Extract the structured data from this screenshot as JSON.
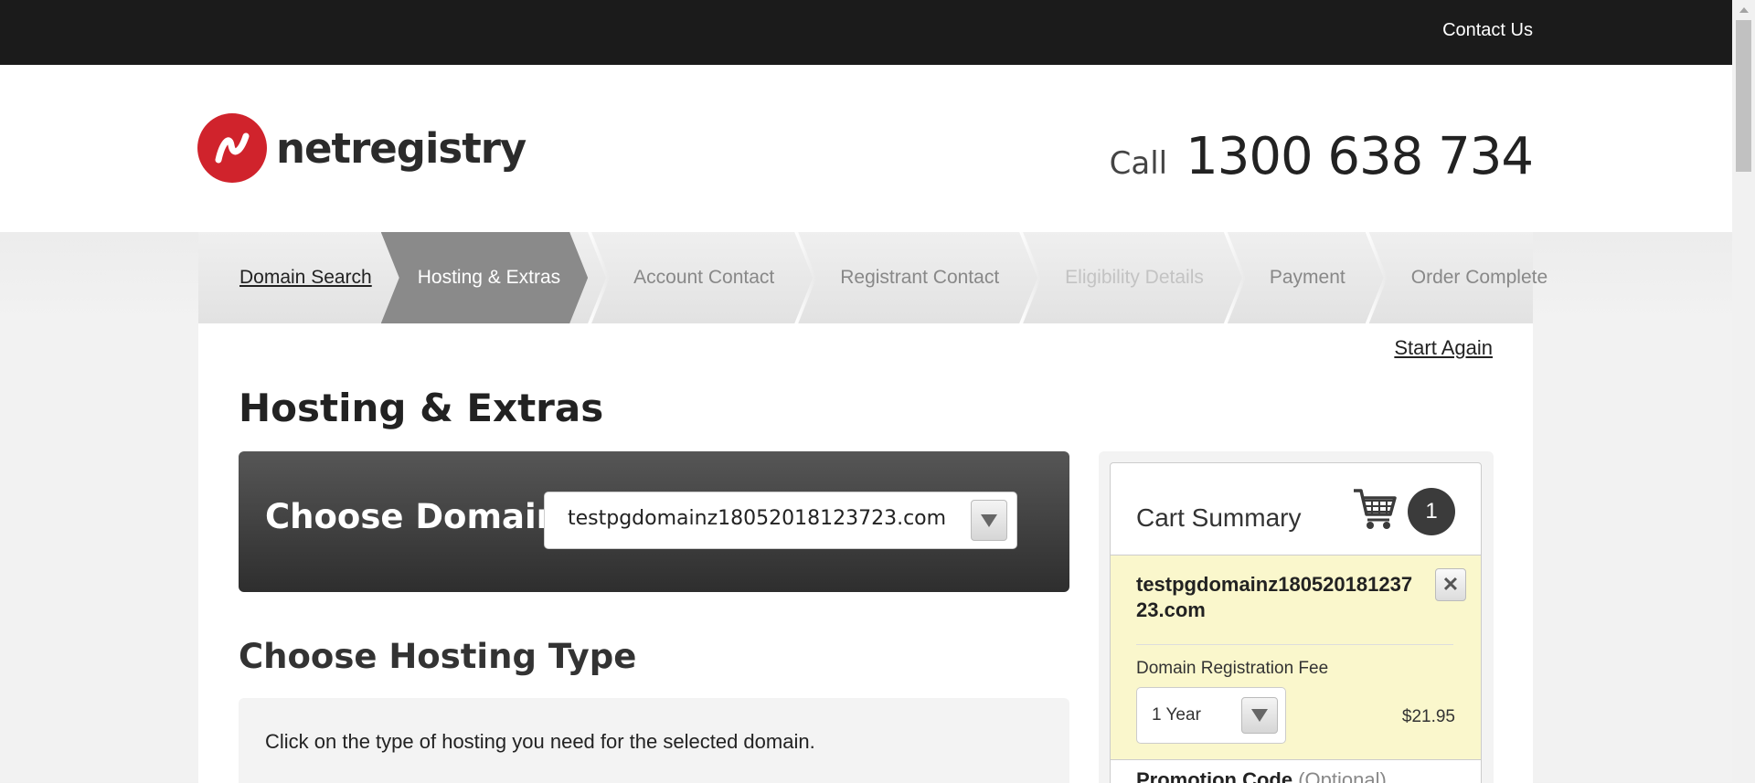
{
  "topbar": {
    "contact_label": "Contact Us"
  },
  "header": {
    "logo_text": "netregistry",
    "call_label": "Call",
    "phone": "1300 638 734"
  },
  "steps": [
    {
      "label": "Domain Search",
      "state": "done"
    },
    {
      "label": "Hosting & Extras",
      "state": "active"
    },
    {
      "label": "Account Contact",
      "state": "pending"
    },
    {
      "label": "Registrant Contact",
      "state": "pending"
    },
    {
      "label": "Eligibility Details",
      "state": "disabled"
    },
    {
      "label": "Payment",
      "state": "pending"
    },
    {
      "label": "Order Complete",
      "state": "pending"
    }
  ],
  "main": {
    "start_again": "Start Again",
    "title": "Hosting & Extras",
    "choose_domain_label": "Choose Domain",
    "selected_domain": "testpgdomainz18052018123723.com",
    "hosting_title": "Choose Hosting Type",
    "hosting_instructions": "Click on the type of hosting you need for the selected domain."
  },
  "cart": {
    "title": "Cart Summary",
    "count": "1",
    "item_domain": "testpgdomainz18052018123723.com",
    "fee_label": "Domain Registration Fee",
    "period": "1 Year",
    "price": "$21.95",
    "promo_label": "Promotion Code",
    "promo_optional": "(Optional)"
  },
  "colors": {
    "topbar": "#1b1b1b",
    "brand_red": "#d0232c",
    "active_step": "#8a8a8a",
    "cart_item_bg": "#faf7cc"
  }
}
